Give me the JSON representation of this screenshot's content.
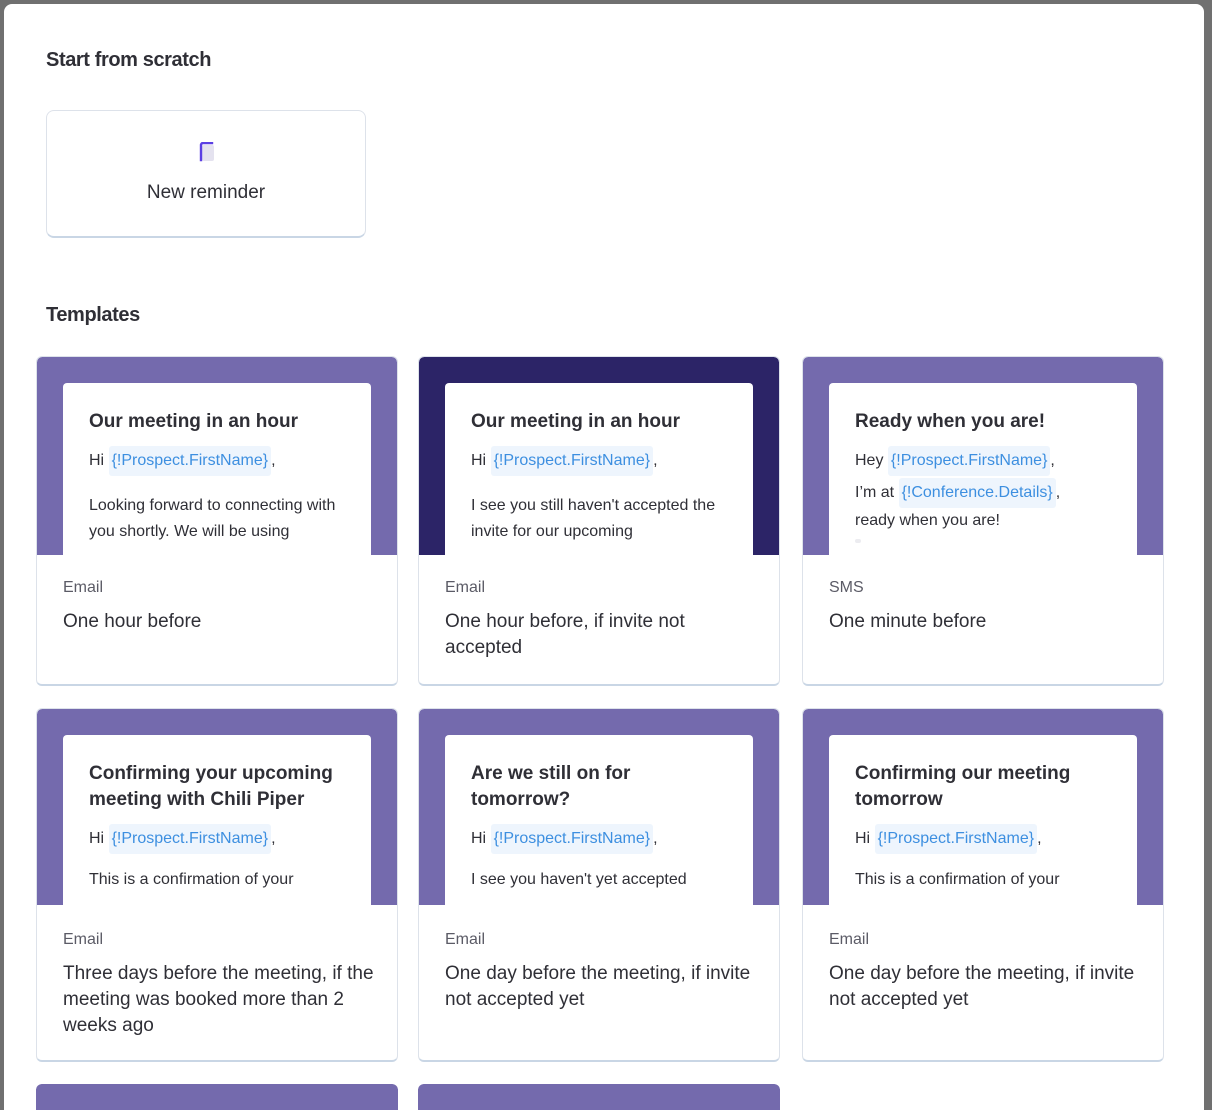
{
  "sections": {
    "scratch_title": "Start from scratch",
    "templates_title": "Templates"
  },
  "new_reminder": {
    "label": "New reminder",
    "icon": "document-icon",
    "accent": "#5b3fe3"
  },
  "colors": {
    "preview_light": "#746aad",
    "preview_dark": "#2c2467",
    "variable_text": "#3d8fe0",
    "variable_bg": "#eef5fd"
  },
  "templates": [
    {
      "subject": "Our meeting in an hour",
      "line1_prefix": "Hi ",
      "line1_var": "{!Prospect.FirstName}",
      "line1_suffix": ",",
      "body": "Looking forward to connecting with you shortly. We will be using",
      "channel": "Email",
      "description": "One hour before"
    },
    {
      "subject": "Our meeting in an hour",
      "line1_prefix": "Hi ",
      "line1_var": "{!Prospect.FirstName}",
      "line1_suffix": ",",
      "body": "I see you still haven't accepted the invite for our upcoming",
      "channel": "Email",
      "description": "One hour before, if invite not accepted"
    },
    {
      "subject": "Ready when you are!",
      "line1_prefix": "Hey ",
      "line1_var": "{!Prospect.FirstName}",
      "line1_suffix": ",",
      "line2_prefix": "I’m at ",
      "line2_var": "{!Conference.Details}",
      "line2_suffix": ",",
      "line3": "ready when you are!",
      "channel": "SMS",
      "description": "One minute before"
    },
    {
      "subject": "Confirming your upcoming meeting with Chili Piper",
      "line1_prefix": "Hi ",
      "line1_var": "{!Prospect.FirstName}",
      "line1_suffix": ",",
      "body": "This is a confirmation of your",
      "channel": "Email",
      "description": "Three days before the meeting, if the meeting was booked more than 2 weeks ago"
    },
    {
      "subject": "Are we still on for tomorrow?",
      "line1_prefix": "Hi ",
      "line1_var": "{!Prospect.FirstName}",
      "line1_suffix": ",",
      "body": "I see you haven't yet accepted",
      "channel": "Email",
      "description": "One day before the meeting, if invite not accepted yet"
    },
    {
      "subject": "Confirming our meeting tomorrow",
      "line1_prefix": "Hi ",
      "line1_var": "{!Prospect.FirstName}",
      "line1_suffix": ",",
      "body": "This is a confirmation of your",
      "channel": "Email",
      "description": "One day before the meeting, if invite not accepted yet"
    }
  ]
}
